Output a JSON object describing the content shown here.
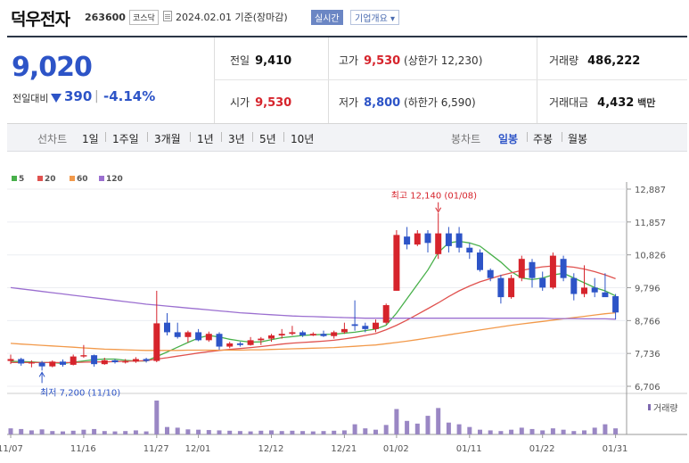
{
  "header": {
    "name": "덕우전자",
    "code": "263600",
    "market": "코스닥",
    "date": "2024.02.01",
    "basis": "기준(장마감)",
    "realtime": "실시간",
    "company_overview": "기업개요"
  },
  "price": {
    "current": "9,020",
    "compare_label": "전일대비",
    "change": "390",
    "change_pct": "-4.14%",
    "prev_label": "전일",
    "prev": "9,410",
    "open_label": "시가",
    "open": "9,530",
    "high_label": "고가",
    "high": "9,530",
    "upper_label": "상한가",
    "upper": "12,230",
    "low_label": "저가",
    "low": "8,800",
    "lower_label": "하한가",
    "lower": "6,590",
    "volume_label": "거래량",
    "volume": "486,222",
    "amount_label": "거래대금",
    "amount": "4,432",
    "amount_unit": "백만",
    "up_color": "#d6242c",
    "down_color": "#2d54c7"
  },
  "period_bar": {
    "line_label": "선차트",
    "line_periods": [
      "1일",
      "1주일",
      "3개월",
      "1년",
      "3년",
      "5년",
      "10년"
    ],
    "candle_label": "봉차트",
    "candle_periods": [
      "일봉",
      "주봉",
      "월봉"
    ],
    "active": "일봉"
  },
  "chart_data": {
    "type": "candlestick",
    "legend": [
      {
        "name": "5",
        "color": "#48b04a"
      },
      {
        "name": "20",
        "color": "#e0524f"
      },
      {
        "name": "60",
        "color": "#f2994a"
      },
      {
        "name": "120",
        "color": "#9b6fd0"
      }
    ],
    "y_ticks": [
      "12,887",
      "11,857",
      "10,826",
      "9,796",
      "8,766",
      "7,736",
      "6,706"
    ],
    "y_tick_values": [
      12887,
      11857,
      10826,
      9796,
      8766,
      7736,
      6706
    ],
    "ylim": [
      6706,
      12887
    ],
    "x_labels": [
      {
        "i": 0,
        "label": "11/07"
      },
      {
        "i": 7,
        "label": "11/16"
      },
      {
        "i": 14,
        "label": "11/27"
      },
      {
        "i": 18,
        "label": "12/01"
      },
      {
        "i": 25,
        "label": "12/12"
      },
      {
        "i": 32,
        "label": "12/21"
      },
      {
        "i": 37,
        "label": "01/02"
      },
      {
        "i": 44,
        "label": "01/11"
      },
      {
        "i": 51,
        "label": "01/22"
      },
      {
        "i": 58,
        "label": "01/31"
      }
    ],
    "high_annotation": "최고 12,140 (01/08)",
    "low_annotation": "최저 7,200 (11/10)",
    "volume_label": "거래량",
    "candles": [
      {
        "o": 7500,
        "h": 7700,
        "l": 7400,
        "c": 7560
      },
      {
        "o": 7560,
        "h": 7600,
        "l": 7350,
        "c": 7420
      },
      {
        "o": 7420,
        "h": 7520,
        "l": 7300,
        "c": 7450
      },
      {
        "o": 7450,
        "h": 7500,
        "l": 7200,
        "c": 7330
      },
      {
        "o": 7330,
        "h": 7520,
        "l": 7300,
        "c": 7480
      },
      {
        "o": 7480,
        "h": 7550,
        "l": 7320,
        "c": 7380
      },
      {
        "o": 7380,
        "h": 7700,
        "l": 7360,
        "c": 7640
      },
      {
        "o": 7640,
        "h": 8000,
        "l": 7600,
        "c": 7680
      },
      {
        "o": 7680,
        "h": 7700,
        "l": 7320,
        "c": 7400
      },
      {
        "o": 7400,
        "h": 7600,
        "l": 7380,
        "c": 7520
      },
      {
        "o": 7520,
        "h": 7560,
        "l": 7420,
        "c": 7460
      },
      {
        "o": 7460,
        "h": 7560,
        "l": 7420,
        "c": 7480
      },
      {
        "o": 7480,
        "h": 7620,
        "l": 7440,
        "c": 7560
      },
      {
        "o": 7560,
        "h": 7600,
        "l": 7450,
        "c": 7500
      },
      {
        "o": 7500,
        "h": 9700,
        "l": 7460,
        "c": 8680
      },
      {
        "o": 8700,
        "h": 9000,
        "l": 8300,
        "c": 8400
      },
      {
        "o": 8400,
        "h": 8700,
        "l": 8200,
        "c": 8250
      },
      {
        "o": 8250,
        "h": 8450,
        "l": 8080,
        "c": 8400
      },
      {
        "o": 8400,
        "h": 8500,
        "l": 8120,
        "c": 8150
      },
      {
        "o": 8150,
        "h": 8420,
        "l": 8100,
        "c": 8350
      },
      {
        "o": 8350,
        "h": 8400,
        "l": 7850,
        "c": 7950
      },
      {
        "o": 7950,
        "h": 8100,
        "l": 7900,
        "c": 8050
      },
      {
        "o": 8050,
        "h": 8100,
        "l": 7950,
        "c": 8000
      },
      {
        "o": 8000,
        "h": 8250,
        "l": 7980,
        "c": 8150
      },
      {
        "o": 8150,
        "h": 8250,
        "l": 8000,
        "c": 8200
      },
      {
        "o": 8200,
        "h": 8350,
        "l": 8100,
        "c": 8300
      },
      {
        "o": 8300,
        "h": 8500,
        "l": 8200,
        "c": 8350
      },
      {
        "o": 8350,
        "h": 8600,
        "l": 8300,
        "c": 8400
      },
      {
        "o": 8400,
        "h": 8450,
        "l": 8250,
        "c": 8300
      },
      {
        "o": 8300,
        "h": 8400,
        "l": 8280,
        "c": 8350
      },
      {
        "o": 8350,
        "h": 8450,
        "l": 8250,
        "c": 8280
      },
      {
        "o": 8280,
        "h": 8450,
        "l": 8200,
        "c": 8400
      },
      {
        "o": 8400,
        "h": 8700,
        "l": 8350,
        "c": 8500
      },
      {
        "o": 8650,
        "h": 9400,
        "l": 8450,
        "c": 8600
      },
      {
        "o": 8600,
        "h": 8700,
        "l": 8400,
        "c": 8500
      },
      {
        "o": 8500,
        "h": 8800,
        "l": 8400,
        "c": 8700
      },
      {
        "o": 8700,
        "h": 9300,
        "l": 8650,
        "c": 9250
      },
      {
        "o": 9700,
        "h": 11600,
        "l": 9700,
        "c": 11450
      },
      {
        "o": 11400,
        "h": 11700,
        "l": 11000,
        "c": 11150
      },
      {
        "o": 11150,
        "h": 11600,
        "l": 11100,
        "c": 11500
      },
      {
        "o": 11500,
        "h": 11600,
        "l": 10900,
        "c": 11200
      },
      {
        "o": 10850,
        "h": 12140,
        "l": 10700,
        "c": 11500
      },
      {
        "o": 11500,
        "h": 11700,
        "l": 10900,
        "c": 11100
      },
      {
        "o": 11500,
        "h": 11700,
        "l": 10900,
        "c": 11050
      },
      {
        "o": 11050,
        "h": 11200,
        "l": 10700,
        "c": 10900
      },
      {
        "o": 10900,
        "h": 11000,
        "l": 10300,
        "c": 10350
      },
      {
        "o": 10350,
        "h": 10400,
        "l": 10000,
        "c": 10100
      },
      {
        "o": 10100,
        "h": 10200,
        "l": 9300,
        "c": 9500
      },
      {
        "o": 9500,
        "h": 10200,
        "l": 9450,
        "c": 10100
      },
      {
        "o": 10100,
        "h": 10800,
        "l": 10000,
        "c": 10700
      },
      {
        "o": 10600,
        "h": 10700,
        "l": 9800,
        "c": 10100
      },
      {
        "o": 10100,
        "h": 10300,
        "l": 9700,
        "c": 9800
      },
      {
        "o": 9800,
        "h": 10900,
        "l": 9750,
        "c": 10800
      },
      {
        "o": 10700,
        "h": 10800,
        "l": 10000,
        "c": 10100
      },
      {
        "o": 10100,
        "h": 10250,
        "l": 9400,
        "c": 9600
      },
      {
        "o": 9600,
        "h": 10500,
        "l": 9500,
        "c": 9800
      },
      {
        "o": 9800,
        "h": 10100,
        "l": 9500,
        "c": 9650
      },
      {
        "o": 9650,
        "h": 10250,
        "l": 9550,
        "c": 9500
      },
      {
        "o": 9530,
        "h": 9600,
        "l": 8800,
        "c": 9020
      }
    ],
    "ma_lines": [
      {
        "name": "5",
        "values": [
          7490,
          7480,
          7470,
          7450,
          7450,
          7420,
          7460,
          7500,
          7540,
          7560,
          7560,
          7520,
          7500,
          7500,
          7640,
          7780,
          7930,
          8080,
          8220,
          8300,
          8250,
          8180,
          8130,
          8090,
          8100,
          8170,
          8230,
          8260,
          8300,
          8320,
          8330,
          8340,
          8370,
          8400,
          8450,
          8500,
          8620,
          9000,
          9450,
          9900,
          10350,
          10900,
          11200,
          11250,
          11200,
          11100,
          10850,
          10600,
          10300,
          10100,
          10050,
          10100,
          10200,
          10250,
          10100,
          9950,
          9800,
          9700,
          9540
        ]
      },
      {
        "name": "20",
        "values": [
          7450,
          7450,
          7450,
          7450,
          7450,
          7450,
          7450,
          7460,
          7470,
          7470,
          7480,
          7490,
          7500,
          7510,
          7560,
          7600,
          7650,
          7700,
          7750,
          7790,
          7830,
          7860,
          7890,
          7920,
          7950,
          7990,
          8030,
          8060,
          8080,
          8100,
          8120,
          8150,
          8190,
          8240,
          8300,
          8360,
          8480,
          8620,
          8780,
          8960,
          9140,
          9320,
          9520,
          9700,
          9850,
          9980,
          10080,
          10180,
          10260,
          10340,
          10400,
          10450,
          10480,
          10470,
          10440,
          10380,
          10300,
          10200,
          10080
        ]
      },
      {
        "name": "60",
        "values": [
          8050,
          8030,
          8010,
          7990,
          7970,
          7950,
          7930,
          7910,
          7890,
          7870,
          7860,
          7850,
          7840,
          7830,
          7830,
          7830,
          7830,
          7840,
          7840,
          7840,
          7840,
          7840,
          7840,
          7850,
          7850,
          7860,
          7870,
          7880,
          7890,
          7900,
          7910,
          7920,
          7940,
          7960,
          7980,
          8000,
          8040,
          8080,
          8120,
          8170,
          8220,
          8270,
          8320,
          8370,
          8420,
          8470,
          8520,
          8570,
          8620,
          8660,
          8700,
          8740,
          8780,
          8820,
          8860,
          8900,
          8940,
          8980,
          9010
        ]
      },
      {
        "name": "120",
        "values": [
          9800,
          9760,
          9720,
          9680,
          9640,
          9600,
          9560,
          9520,
          9480,
          9440,
          9400,
          9360,
          9320,
          9280,
          9250,
          9220,
          9190,
          9160,
          9130,
          9100,
          9070,
          9040,
          9010,
          8990,
          8970,
          8950,
          8930,
          8910,
          8900,
          8890,
          8880,
          8870,
          8860,
          8850,
          8840,
          8840,
          8840,
          8840,
          8840,
          8840,
          8840,
          8840,
          8840,
          8840,
          8840,
          8840,
          8840,
          8840,
          8840,
          8840,
          8840,
          8840,
          8830,
          8830,
          8830,
          8820,
          8820,
          8820,
          8810
        ]
      }
    ],
    "volumes": [
      18,
      16,
      12,
      15,
      10,
      9,
      11,
      14,
      16,
      10,
      9,
      10,
      12,
      9,
      100,
      22,
      20,
      15,
      14,
      13,
      12,
      11,
      10,
      9,
      11,
      12,
      10,
      11,
      10,
      9,
      10,
      11,
      12,
      30,
      18,
      14,
      28,
      75,
      40,
      32,
      55,
      78,
      35,
      30,
      22,
      14,
      12,
      10,
      14,
      20,
      16,
      12,
      18,
      14,
      10,
      12,
      20,
      30,
      18
    ]
  }
}
